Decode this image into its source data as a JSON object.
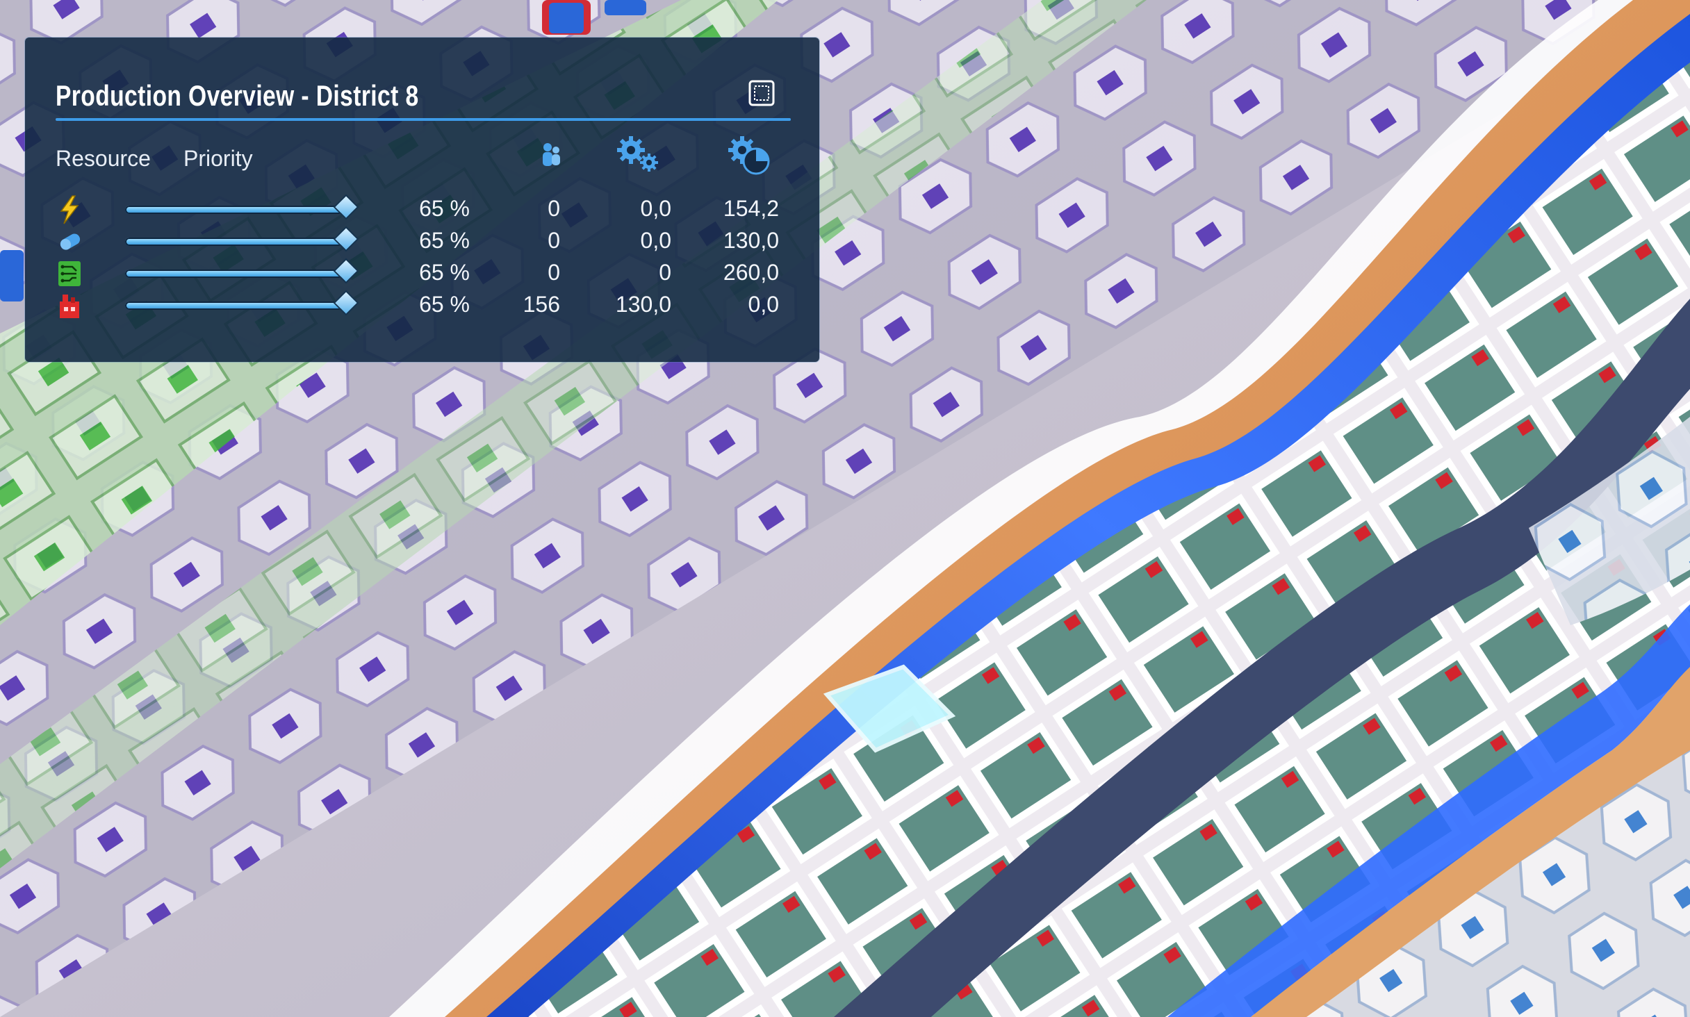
{
  "panel": {
    "title": "Production Overview - District 8",
    "minimize_icon": "square-frame-icon",
    "columns": {
      "resource": "Resource",
      "priority": "Priority",
      "workers_icon": "people-icon",
      "production_icon": "gears-icon",
      "capacity_icon": "gear-pie-icon"
    },
    "rows": [
      {
        "icon": "lightning-icon",
        "icon_color": "#f6c81d",
        "priority": "65 %",
        "priority_fraction": 0.65,
        "workers": "0",
        "production": "0,0",
        "capacity": "154,2"
      },
      {
        "icon": "capsule-icon",
        "icon_color": "#4aa3ec",
        "priority": "65 %",
        "priority_fraction": 0.65,
        "workers": "0",
        "production": "0,0",
        "capacity": "130,0"
      },
      {
        "icon": "circuit-board-icon",
        "icon_color": "#3fb53a",
        "priority": "65 %",
        "priority_fraction": 0.65,
        "workers": "0",
        "production": "0",
        "capacity": "260,0"
      },
      {
        "icon": "factory-icon",
        "icon_color": "#e02b2b",
        "priority": "65 %",
        "priority_fraction": 0.65,
        "workers": "156",
        "production": "130,0",
        "capacity": "0,0"
      }
    ]
  },
  "colors": {
    "panel_bg": "#142a44",
    "accent": "#3d9be8"
  }
}
